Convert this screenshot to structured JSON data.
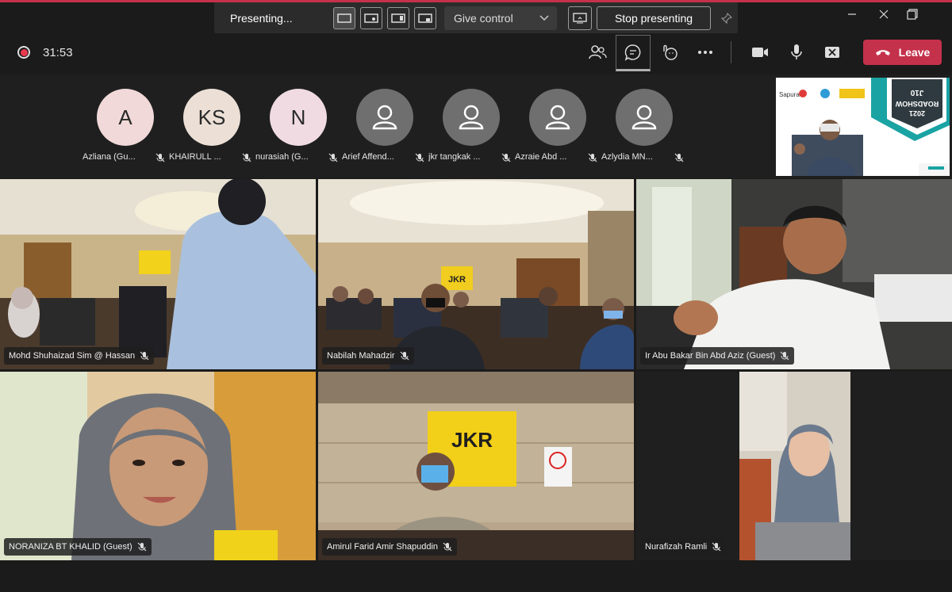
{
  "presenting_bar": {
    "label": "Presenting...",
    "give_control": "Give control",
    "stop_presenting": "Stop presenting"
  },
  "meeting": {
    "timer": "31:53",
    "leave_label": "Leave"
  },
  "participants": [
    {
      "initials": "A",
      "name": "Azliana (Gu..."
    },
    {
      "initials": "KS",
      "name": "KHAIRULL ..."
    },
    {
      "initials": "N",
      "name": "nurasiah (G..."
    },
    {
      "initials": "",
      "name": "Arief Affend..."
    },
    {
      "initials": "",
      "name": "jkr tangkak ..."
    },
    {
      "initials": "",
      "name": "Azraie Abd ..."
    },
    {
      "initials": "",
      "name": "Azlydia MN..."
    }
  ],
  "shared_screen": {
    "banner_line1": "J10",
    "banner_line2": "ROADSHOW",
    "banner_line3": "2021",
    "logo_text": "Sapura"
  },
  "video_tiles": [
    {
      "name": "Mohd Shuhaizad Sim @ Hassan"
    },
    {
      "name": "Nabilah Mahadzir"
    },
    {
      "name": "Ir Abu Bakar Bin Abd Aziz (Guest)"
    },
    {
      "name": "NORANIZA BT KHALID (Guest)"
    },
    {
      "name": "Amirul Farid Amir Shapuddin"
    },
    {
      "name": "Nurafizah Ramli"
    }
  ],
  "room_signs": {
    "jkr_small": "JKR",
    "jkr_large": "JKR"
  },
  "icons": [
    "layout-icon",
    "chevron-down-icon",
    "screen-icon",
    "pin-icon",
    "minimize-icon",
    "maximize-icon",
    "close-icon",
    "record-icon",
    "people-icon",
    "chat-icon",
    "reactions-icon",
    "more-icon",
    "camera-icon",
    "mic-icon",
    "share-icon",
    "phone-icon",
    "mic-off-icon"
  ],
  "colors": {
    "leave": "#c4314b",
    "record": "#e8394f",
    "background": "#1b1b1b"
  }
}
